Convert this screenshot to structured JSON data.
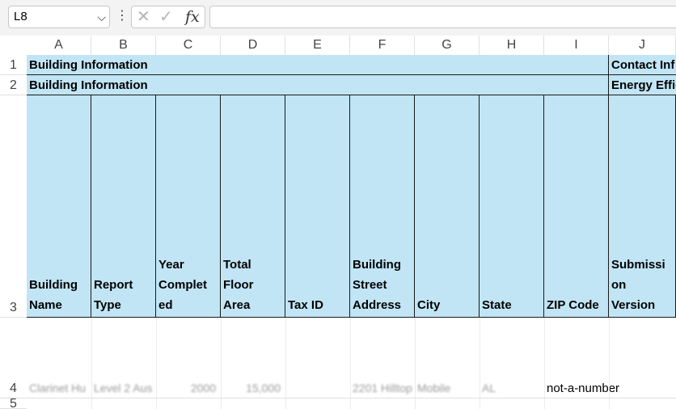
{
  "formula_bar": {
    "name_box": "L8",
    "chevron_glyph": "⌵",
    "kebab_glyph": "⋮",
    "cancel_glyph": "✕",
    "enter_glyph": "✓",
    "fx_glyph": "fx",
    "formula": ""
  },
  "columns": [
    "A",
    "B",
    "C",
    "D",
    "E",
    "F",
    "G",
    "H",
    "I",
    "J"
  ],
  "rows": [
    "1",
    "2",
    "3",
    "4",
    "5"
  ],
  "row1": {
    "left": "Building Information",
    "right": "Contact Inf"
  },
  "row2": {
    "left": "Building Information",
    "right": "Energy Effic"
  },
  "row3": [
    [
      "Building",
      "Name"
    ],
    [
      "Report",
      "Type"
    ],
    [
      "Year",
      "Complet",
      "ed"
    ],
    [
      "Total",
      "Floor",
      "Area"
    ],
    [
      "Tax ID"
    ],
    [
      "Building",
      "Street",
      "Address"
    ],
    [
      "City"
    ],
    [
      "State"
    ],
    [
      "ZIP Code"
    ],
    [
      "Submissi",
      "on",
      "Version"
    ]
  ],
  "row4": [
    "Clarinet Hu",
    "Level 2 Aus",
    "2000",
    "15,000",
    "",
    "2201 Hilltop",
    "Mobile",
    "AL",
    "not-a-number",
    ""
  ]
}
